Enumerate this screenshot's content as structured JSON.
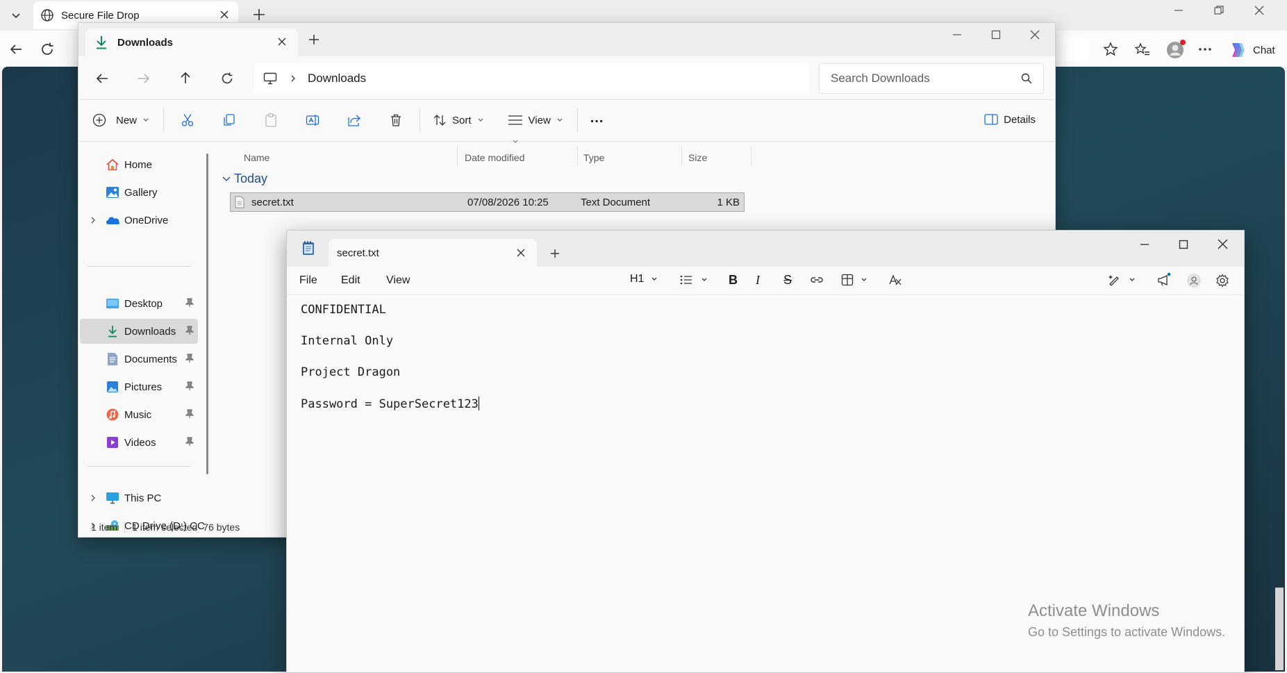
{
  "browser": {
    "tab_title": "Secure File Drop",
    "chat_label": "Chat"
  },
  "explorer": {
    "tab_title": "Downloads",
    "breadcrumb": "Downloads",
    "search_placeholder": "Search Downloads",
    "commands": {
      "new": "New",
      "sort": "Sort",
      "view": "View",
      "more": "...",
      "details": "Details"
    },
    "columns": [
      "Name",
      "Date modified",
      "Type",
      "Size"
    ],
    "group": "Today",
    "files": [
      {
        "name": "secret.txt",
        "date": "07/08/2026 10:25",
        "type": "Text Document",
        "size": "1 KB"
      }
    ],
    "nav": {
      "home": "Home",
      "gallery": "Gallery",
      "onedrive": "OneDrive",
      "desktop": "Desktop",
      "downloads": "Downloads",
      "documents": "Documents",
      "pictures": "Pictures",
      "music": "Music",
      "videos": "Videos",
      "thispc": "This PC",
      "cddrive": "CD Drive (D:) CC"
    },
    "status": {
      "count": "1 item",
      "selected": "1 item selected",
      "size": "76 bytes"
    }
  },
  "notepad": {
    "tab_title": "secret.txt",
    "menu": {
      "file": "File",
      "edit": "Edit",
      "view": "View"
    },
    "heading_label": "H1",
    "lines": [
      "CONFIDENTIAL",
      "Internal Only",
      "Project Dragon",
      "Password = SuperSecret123"
    ]
  },
  "watermark": {
    "title": "Activate Windows",
    "subtitle": "Go to Settings to activate Windows."
  },
  "colors": {
    "accent": "#0067c0",
    "selection": "#cce8ff",
    "folder": "#f2c14e"
  }
}
